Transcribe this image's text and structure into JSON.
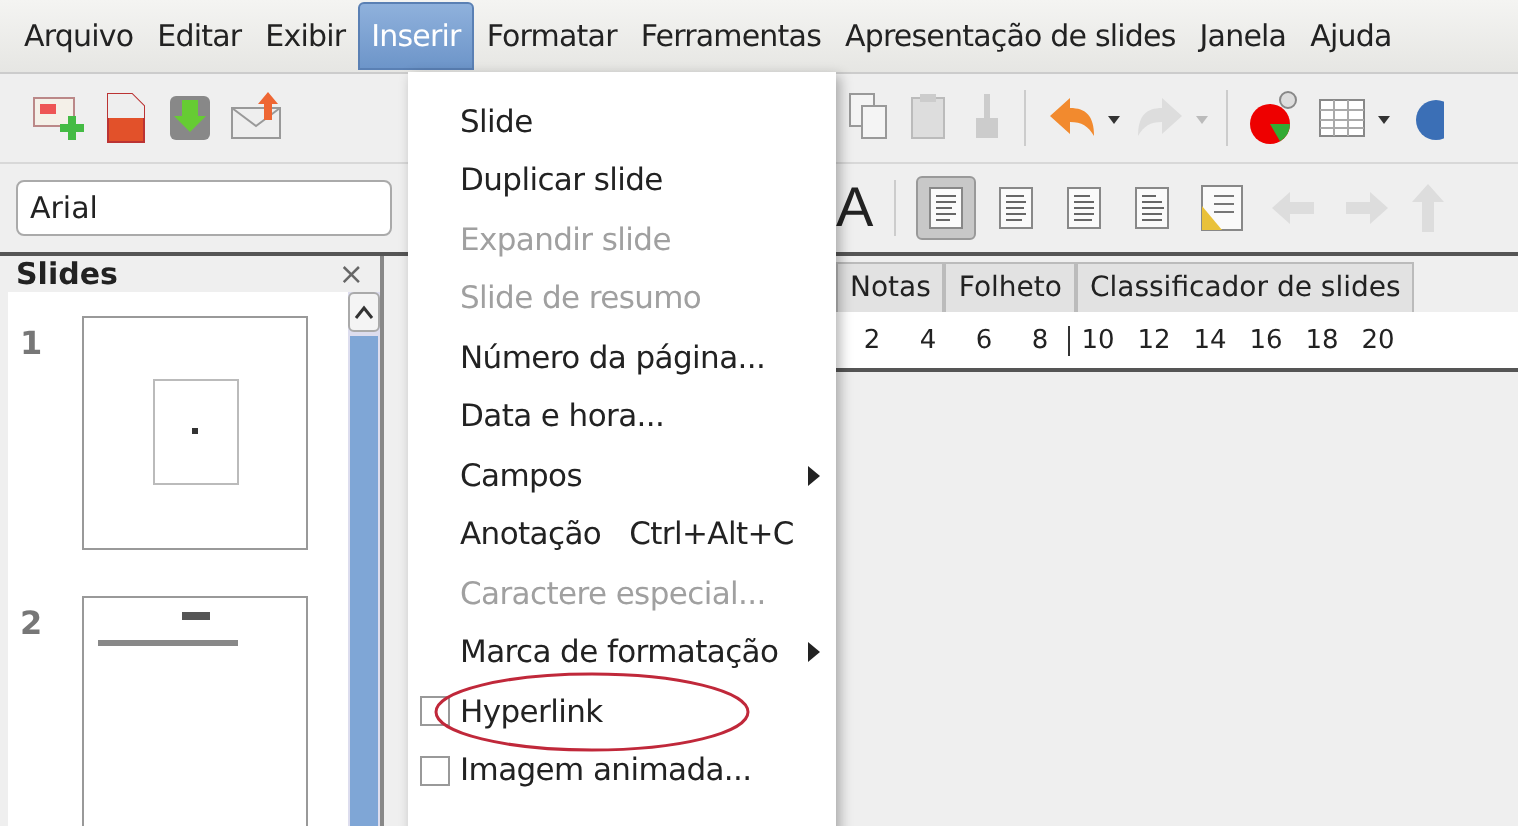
{
  "menubar": [
    {
      "label": "Arquivo",
      "selected": false
    },
    {
      "label": "Editar",
      "selected": false
    },
    {
      "label": "Exibir",
      "selected": false
    },
    {
      "label": "Inserir",
      "selected": true
    },
    {
      "label": "Formatar",
      "selected": false
    },
    {
      "label": "Ferramentas",
      "selected": false
    },
    {
      "label": "Apresentação de slides",
      "selected": false
    },
    {
      "label": "Janela",
      "selected": false
    },
    {
      "label": "Ajuda",
      "selected": false
    }
  ],
  "format_toolbar": {
    "font_name": "Arial",
    "glyph_button": "A",
    "align_buttons": [
      {
        "selected": true
      },
      {
        "selected": false
      },
      {
        "selected": false
      },
      {
        "selected": false
      }
    ]
  },
  "slides_panel": {
    "title": "Slides",
    "close": "×",
    "slides": [
      {
        "number": "1"
      },
      {
        "number": "2"
      }
    ]
  },
  "view_tabs": [
    {
      "label": "Notas"
    },
    {
      "label": "Folheto"
    },
    {
      "label": "Classificador de slides"
    }
  ],
  "ruler": [
    "2",
    "4",
    "6",
    "8",
    "10",
    "12",
    "14",
    "16",
    "18",
    "20"
  ],
  "menu": {
    "items": [
      {
        "label": "Slide",
        "kind": "plain",
        "disabled": false,
        "circled": false
      },
      {
        "label": "Duplicar slide",
        "kind": "plain",
        "disabled": false,
        "circled": false
      },
      {
        "label": "Expandir slide",
        "kind": "plain",
        "disabled": true,
        "circled": false
      },
      {
        "label": "Slide de resumo",
        "kind": "plain",
        "disabled": true,
        "circled": false
      },
      {
        "label": "Número da página...",
        "kind": "plain",
        "disabled": false,
        "circled": false
      },
      {
        "label": "Data e hora...",
        "kind": "plain",
        "disabled": false,
        "circled": false
      },
      {
        "label": "Campos",
        "kind": "submenu",
        "disabled": false,
        "circled": false
      },
      {
        "label": "Anotação",
        "kind": "shortcut",
        "shortcut": "Ctrl+Alt+C",
        "disabled": false,
        "circled": false
      },
      {
        "label": "Caractere especial...",
        "kind": "plain",
        "disabled": true,
        "circled": false
      },
      {
        "label": "Marca de formatação",
        "kind": "submenu",
        "disabled": false,
        "circled": false
      },
      {
        "label": "Hyperlink",
        "kind": "checkbox",
        "disabled": false,
        "circled": true
      },
      {
        "label": "Imagem animada...",
        "kind": "checkbox",
        "disabled": false,
        "circled": false
      }
    ]
  }
}
